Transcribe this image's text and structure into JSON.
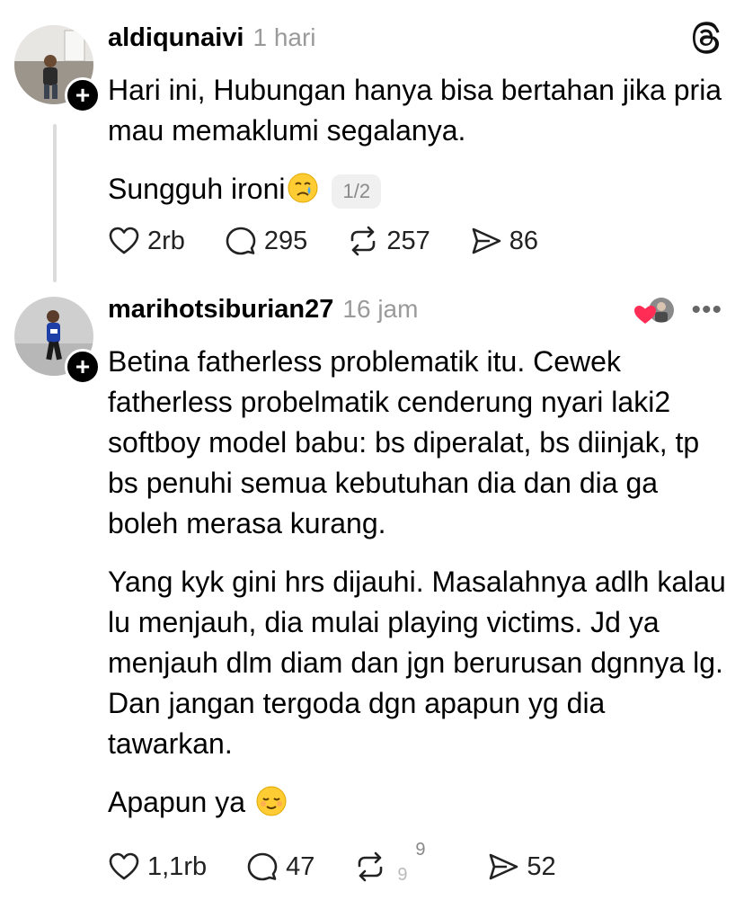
{
  "posts": [
    {
      "username": "aldiqunaivi",
      "time": "1 hari",
      "paragraphs": [
        "Hari ini, Hubungan hanya bisa bertahan jika pria mau memaklumi segalanya.",
        "Sungguh ironi"
      ],
      "emoji": "crying-face",
      "page_indicator": "1/2",
      "likes": "2rb",
      "replies": "295",
      "reposts": "257",
      "shares": "86"
    },
    {
      "username": "marihotsiburian27",
      "time": "16 jam",
      "paragraphs": [
        "Betina fatherless problematik itu. Cewek fatherless probelmatik cenderung nyari laki2 softboy model babu: bs diperalat, bs diinjak, tp bs penuhi semua kebutuhan dia dan dia ga boleh merasa kurang.",
        "Yang kyk gini hrs dijauhi. Masalahnya adlh kalau lu menjauh, dia mulai playing victims. Jd ya menjauh dlm diam dan jgn berurusan dgnnya lg. Dan jangan tergoda dgn apapun yg dia tawarkan.",
        "Apapun ya"
      ],
      "emoji": "relieved-face",
      "likes": "1,1rb",
      "replies": "47",
      "reposts_rolling": [
        "9",
        "9"
      ],
      "shares": "52"
    }
  ],
  "icons": {
    "app": "threads-logo-icon",
    "follow": "plus-icon",
    "like": "heart-icon",
    "reply": "comment-icon",
    "repost": "repost-icon",
    "share": "send-icon",
    "more": "more-dots-icon"
  },
  "colors": {
    "accent_heart": "#ff2d55",
    "muted": "#9a9a9a",
    "thread_line": "#dcdcdc"
  }
}
